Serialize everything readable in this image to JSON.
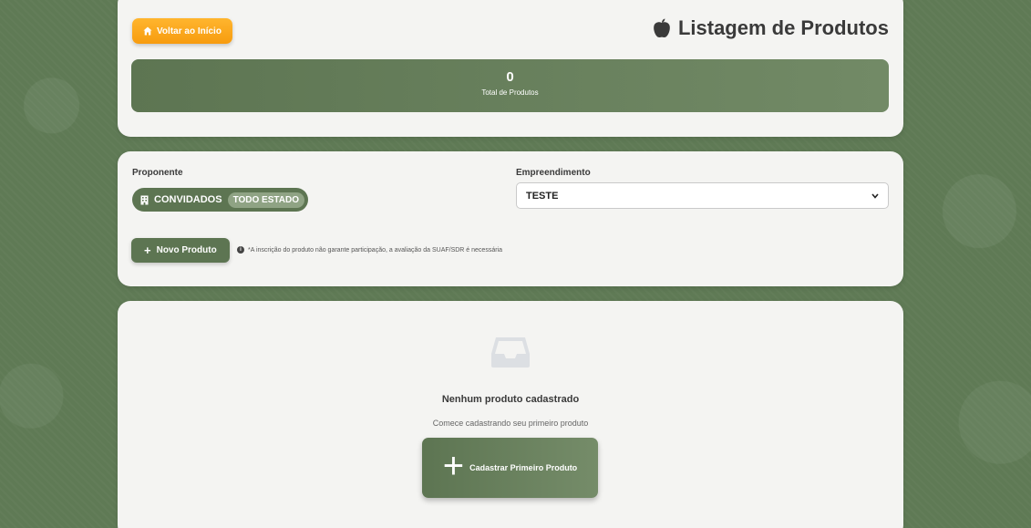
{
  "header": {
    "home_button": "Voltar ao Início",
    "page_title": "Listagem de Produtos",
    "stat_value": "0",
    "stat_label": "Total de Produtos"
  },
  "filters": {
    "proponente_label": "Proponente",
    "proponente_name": "CONVIDADOS",
    "proponente_scope": "TODO ESTADO",
    "empreendimento_label": "Empreendimento",
    "empreendimento_value": "TESTE",
    "new_product_button": "Novo Produto",
    "notice": "*A inscrição do produto não garante participação, a avaliação da SUAF/SDR é necessária"
  },
  "empty_state": {
    "title": "Nenhum produto cadastrado",
    "subtitle": "Comece cadastrando seu primeiro produto",
    "cta_button": "Cadastrar Primeiro Produto"
  },
  "colors": {
    "accent_green": "#5d7552",
    "accent_orange": "#f79c0f",
    "background": "#5f7a55"
  }
}
